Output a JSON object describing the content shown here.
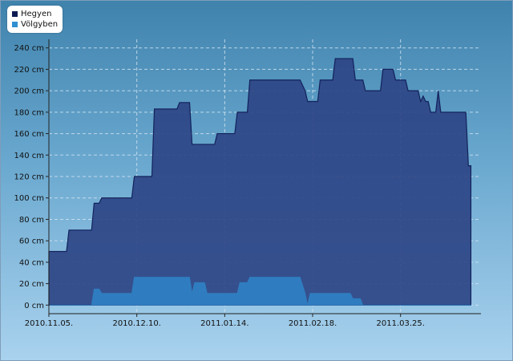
{
  "chart_data": {
    "type": "area",
    "legend_position": "top-left",
    "grid": true,
    "ylim": [
      -8,
      248
    ],
    "yticks": [
      0,
      20,
      40,
      60,
      80,
      100,
      120,
      140,
      160,
      180,
      200,
      220,
      240
    ],
    "ytick_labels": [
      "0 cm",
      "20 cm",
      "40 cm",
      "60 cm",
      "80 cm",
      "100 cm",
      "120 cm",
      "140 cm",
      "160 cm",
      "180 cm",
      "200 cm",
      "220 cm",
      "240 cm"
    ],
    "xlim": [
      "2010-11-05",
      "2011-04-26"
    ],
    "xticks": [
      "2010-11-05",
      "2010-12-10",
      "2011-01-14",
      "2011-02-18",
      "2011-03-25"
    ],
    "xtick_labels": [
      "2010.11.05.",
      "2010.12.10.",
      "2011.01.14.",
      "2011.02.18.",
      "2011.03.25."
    ],
    "series": [
      {
        "name": "Hegyen",
        "color": "#2e4585",
        "line_color": "#12225c",
        "points": [
          [
            "2010-11-05",
            50
          ],
          [
            "2010-11-12",
            50
          ],
          [
            "2010-11-13",
            70
          ],
          [
            "2010-11-22",
            70
          ],
          [
            "2010-11-23",
            95
          ],
          [
            "2010-11-25",
            95
          ],
          [
            "2010-11-26",
            100
          ],
          [
            "2010-12-08",
            100
          ],
          [
            "2010-12-09",
            120
          ],
          [
            "2010-12-16",
            120
          ],
          [
            "2010-12-17",
            183
          ],
          [
            "2010-12-26",
            183
          ],
          [
            "2010-12-27",
            189
          ],
          [
            "2010-12-31",
            189
          ],
          [
            "2011-01-01",
            150
          ],
          [
            "2011-01-10",
            150
          ],
          [
            "2011-01-11",
            160
          ],
          [
            "2011-01-18",
            160
          ],
          [
            "2011-01-19",
            180
          ],
          [
            "2011-01-23",
            180
          ],
          [
            "2011-01-24",
            210
          ],
          [
            "2011-02-13",
            210
          ],
          [
            "2011-02-15",
            200
          ],
          [
            "2011-02-16",
            190
          ],
          [
            "2011-02-20",
            190
          ],
          [
            "2011-02-21",
            210
          ],
          [
            "2011-02-26",
            210
          ],
          [
            "2011-02-27",
            230
          ],
          [
            "2011-03-06",
            230
          ],
          [
            "2011-03-07",
            210
          ],
          [
            "2011-03-10",
            210
          ],
          [
            "2011-03-11",
            200
          ],
          [
            "2011-03-17",
            200
          ],
          [
            "2011-03-18",
            220
          ],
          [
            "2011-03-22",
            220
          ],
          [
            "2011-03-23",
            210
          ],
          [
            "2011-03-27",
            210
          ],
          [
            "2011-03-28",
            200
          ],
          [
            "2011-04-01",
            200
          ],
          [
            "2011-04-02",
            190
          ],
          [
            "2011-04-03",
            195
          ],
          [
            "2011-04-04",
            190
          ],
          [
            "2011-04-05",
            190
          ],
          [
            "2011-04-06",
            180
          ],
          [
            "2011-04-08",
            180
          ],
          [
            "2011-04-09",
            200
          ],
          [
            "2011-04-10",
            180
          ],
          [
            "2011-04-20",
            180
          ],
          [
            "2011-04-21",
            130
          ],
          [
            "2011-04-22",
            130
          ]
        ]
      },
      {
        "name": "Völgyben",
        "color": "#2f7dc0",
        "line_color": "#2f7dc0",
        "points": [
          [
            "2010-11-05",
            0
          ],
          [
            "2010-11-22",
            0
          ],
          [
            "2010-11-23",
            15
          ],
          [
            "2010-11-25",
            15
          ],
          [
            "2010-11-26",
            11
          ],
          [
            "2010-12-08",
            11
          ],
          [
            "2010-12-09",
            26
          ],
          [
            "2010-12-31",
            26
          ],
          [
            "2011-01-01",
            11
          ],
          [
            "2011-01-02",
            21
          ],
          [
            "2011-01-06",
            21
          ],
          [
            "2011-01-07",
            11
          ],
          [
            "2011-01-19",
            11
          ],
          [
            "2011-01-20",
            21
          ],
          [
            "2011-01-23",
            21
          ],
          [
            "2011-01-24",
            26
          ],
          [
            "2011-02-13",
            26
          ],
          [
            "2011-02-15",
            11
          ],
          [
            "2011-02-16",
            0
          ],
          [
            "2011-02-17",
            11
          ],
          [
            "2011-03-05",
            11
          ],
          [
            "2011-03-06",
            6
          ],
          [
            "2011-03-09",
            6
          ],
          [
            "2011-03-10",
            0
          ],
          [
            "2011-04-22",
            0
          ]
        ]
      }
    ]
  }
}
